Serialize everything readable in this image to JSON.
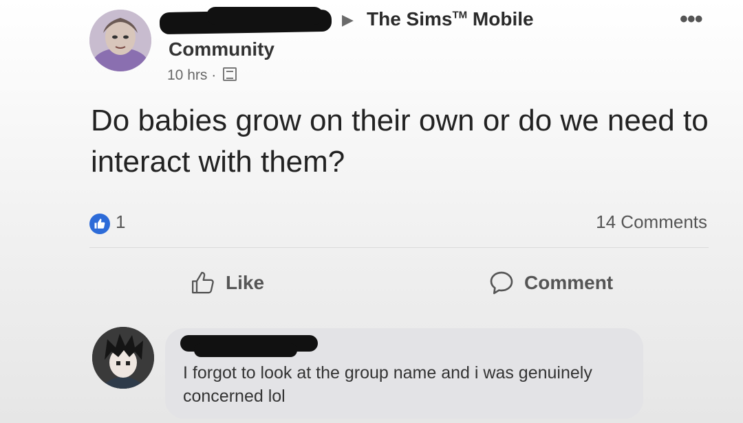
{
  "post": {
    "group_name": "The Sims",
    "group_trademark": "TM",
    "group_name_suffix": " Mobile",
    "group_arrow": "▶",
    "more_label": "•••",
    "community_label": "Community",
    "timestamp": "10 hrs",
    "separator": "·",
    "text": "Do babies grow on their own or do we need to interact with them?",
    "reaction_count": "1",
    "comments_count": "14 Comments"
  },
  "actions": {
    "like_label": "Like",
    "comment_label": "Comment"
  },
  "comment": {
    "text": "I forgot to look at the group name and i was genuinely concerned lol"
  },
  "colors": {
    "like_blue": "#2d6bd8",
    "redaction": "#111111"
  },
  "icons": [
    "avatar",
    "caret-right-icon",
    "more-icon",
    "group-privacy-icon",
    "like-reaction-icon",
    "thumbs-up-icon",
    "comment-icon"
  ]
}
